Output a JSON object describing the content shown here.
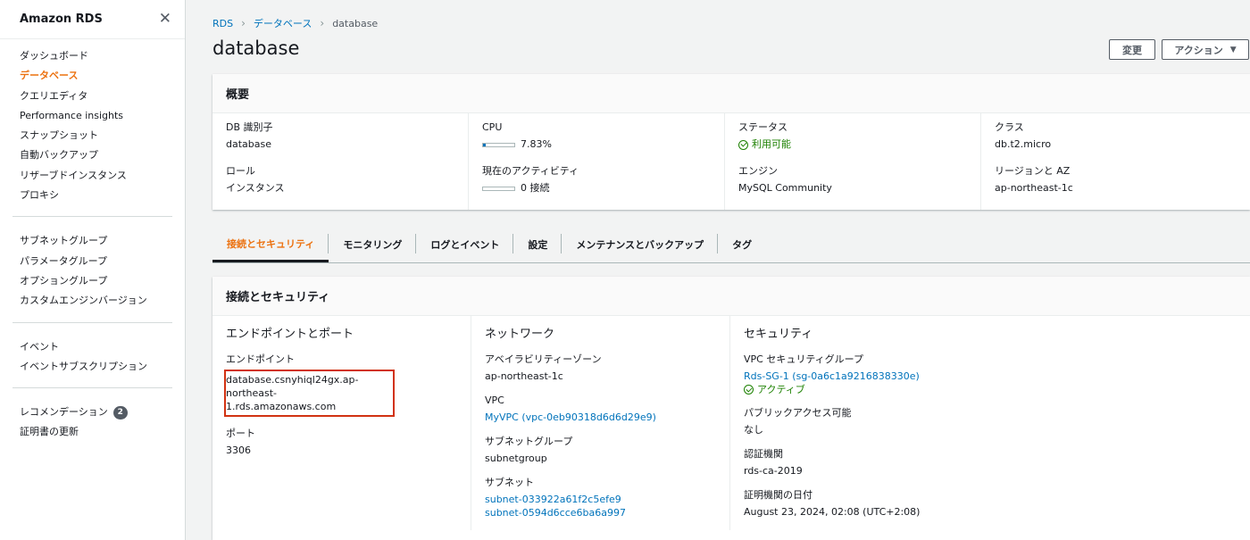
{
  "sidebar": {
    "title": "Amazon RDS",
    "group1": [
      "ダッシュボード",
      "データベース",
      "クエリエディタ",
      "Performance insights",
      "スナップショット",
      "自動バックアップ",
      "リザーブドインスタンス",
      "プロキシ"
    ],
    "group2": [
      "サブネットグループ",
      "パラメータグループ",
      "オプショングループ",
      "カスタムエンジンバージョン"
    ],
    "group3": [
      "イベント",
      "イベントサブスクリプション"
    ],
    "group4": [
      "レコメンデーション",
      "証明書の更新"
    ],
    "recommendation_count": "2",
    "active_item": "データベース"
  },
  "breadcrumb": [
    "RDS",
    "データベース",
    "database"
  ],
  "page_title": "database",
  "buttons": {
    "modify": "変更",
    "actions": "アクション"
  },
  "summary": {
    "header": "概要",
    "db_id_label": "DB 識別子",
    "db_id": "database",
    "role_label": "ロール",
    "role": "インスタンス",
    "cpu_label": "CPU",
    "cpu": "7.83%",
    "cpu_fraction": 0.0783,
    "activity_label": "現在のアクティビティ",
    "activity": "0 接続",
    "status_label": "ステータス",
    "status": "利用可能",
    "engine_label": "エンジン",
    "engine": "MySQL Community",
    "class_label": "クラス",
    "class": "db.t2.micro",
    "region_label": "リージョンと AZ",
    "region": "ap-northeast-1c"
  },
  "tabs": [
    "接続とセキュリティ",
    "モニタリング",
    "ログとイベント",
    "設定",
    "メンテナンスとバックアップ",
    "タグ"
  ],
  "connectivity": {
    "header": "接続とセキュリティ",
    "endpoint_section": "エンドポイントとポート",
    "endpoint_label": "エンドポイント",
    "endpoint_line1": "database.csnyhiql24gx.ap-northeast-",
    "endpoint_line2": "1.rds.amazonaws.com",
    "port_label": "ポート",
    "port": "3306",
    "network_section": "ネットワーク",
    "az_label": "アベイラビリティーゾーン",
    "az": "ap-northeast-1c",
    "vpc_label": "VPC",
    "vpc": "MyVPC (vpc-0eb90318d6d6d29e9)",
    "subnet_group_label": "サブネットグループ",
    "subnet_group": "subnetgroup",
    "subnets_label": "サブネット",
    "subnets": [
      "subnet-033922a61f2c5efe9",
      "subnet-0594d6cce6ba6a997"
    ],
    "security_section": "セキュリティ",
    "sg_label": "VPC セキュリティグループ",
    "sg": "Rds-SG-1 (sg-0a6c1a9216838330e)",
    "sg_status": "アクティブ",
    "public_label": "パブリックアクセス可能",
    "public": "なし",
    "ca_label": "認証機関",
    "ca": "rds-ca-2019",
    "ca_date_label": "証明機関の日付",
    "ca_date": "August 23, 2024, 02:08 (UTC+2:08)"
  },
  "colors": {
    "accent": "#ec7211",
    "link": "#0073bb",
    "success": "#1d8102",
    "highlight": "#d13212"
  }
}
